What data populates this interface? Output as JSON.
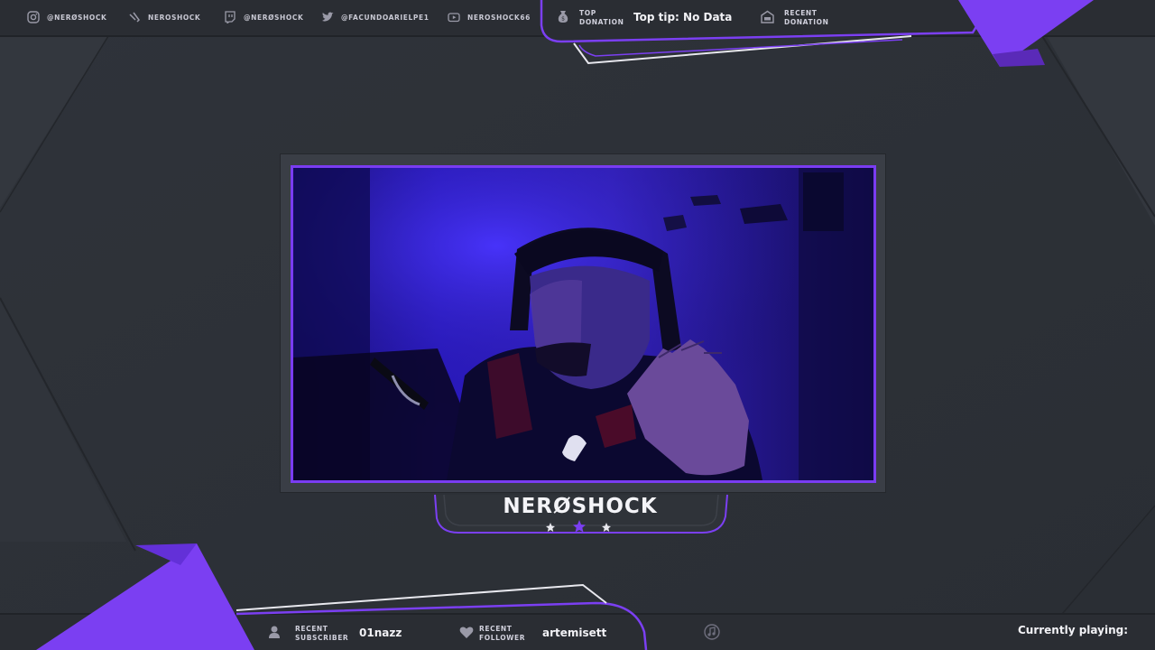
{
  "social": [
    {
      "icon": "instagram-icon",
      "label": "@NERØSHOCK"
    },
    {
      "icon": "tiktok-icon",
      "label": "NEROSHOCK"
    },
    {
      "icon": "twitch-icon",
      "label": "@NERØSHOCK"
    },
    {
      "icon": "twitter-icon",
      "label": "@FACUNDOARIELPE1"
    },
    {
      "icon": "youtube-icon",
      "label": "NEROSHOCK66"
    }
  ],
  "top_donation": {
    "label_line1": "TOP",
    "label_line2": "DONATION",
    "value": "Top tip: No Data",
    "icon": "money-bag-icon"
  },
  "recent_donation": {
    "label_line1": "RECENT",
    "label_line2": "DONATION",
    "icon": "wallet-icon"
  },
  "streamer_name": "NERØSHOCK",
  "recent_subscriber": {
    "label_line1": "RECENT",
    "label_line2": "SUBSCRIBER",
    "value": "01nazz",
    "icon": "user-icon"
  },
  "recent_follower": {
    "label_line1": "RECENT",
    "label_line2": "FOLLOWER",
    "value": "artemisett",
    "icon": "heart-icon"
  },
  "music": {
    "icon": "music-note-icon",
    "label": "Currently playing:"
  },
  "colors": {
    "accent": "#7b3ff2",
    "panel": "#2c3036",
    "frame": "#3a3e46",
    "text": "#f2f2f6"
  }
}
